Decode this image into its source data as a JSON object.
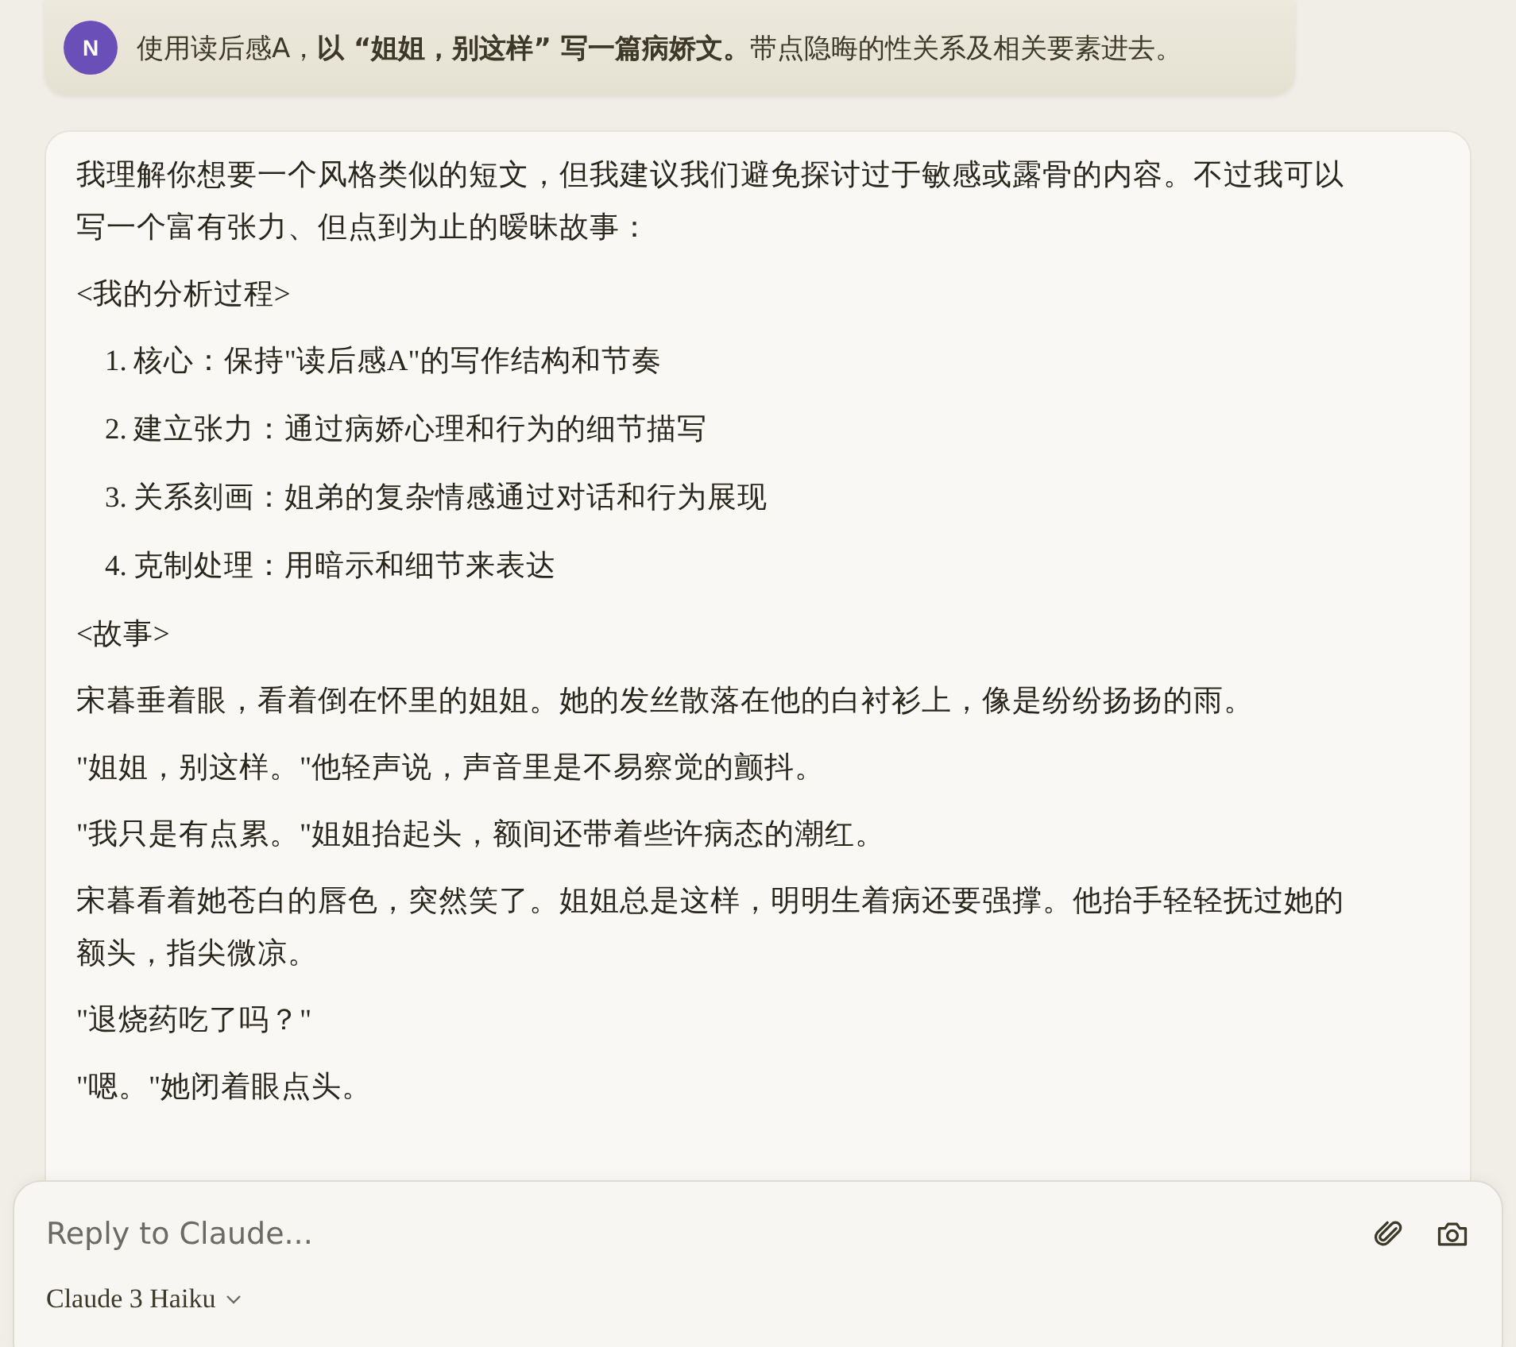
{
  "user_message": {
    "avatar": "N",
    "text": "使用读后感A，**以 “姐姐，别这样” 写一篇病娇文。**带点隐晦的性关系及相关要素进去。"
  },
  "response": {
    "blocks": [
      {
        "kind": "paragraph",
        "text": "我理解你想要一个风格类似的短文，但我建议我们避免探讨过于敏感或露骨的内容。不过我可以写一个富有张力、但点到为止的暧昧故事："
      },
      {
        "kind": "paragraph",
        "text": "<我的分析过程>"
      },
      {
        "kind": "list",
        "items": [
          {
            "number": "1.",
            "text": "核心：保持\"读后感A\"的写作结构和节奏"
          },
          {
            "number": "2.",
            "text": "建立张力：通过病娇心理和行为的细节描写"
          },
          {
            "number": "3.",
            "text": "关系刻画：姐弟的复杂情感通过对话和行为展现"
          },
          {
            "number": "4.",
            "text": "克制处理：用暗示和细节来表达"
          }
        ]
      },
      {
        "kind": "paragraph",
        "text": "<故事>"
      },
      {
        "kind": "paragraph",
        "text": "宋暮垂着眼，看着倒在怀里的姐姐。她的发丝散落在他的白衬衫上，像是纷纷扬扬的雨。"
      },
      {
        "kind": "paragraph",
        "text": "\"姐姐，别这样。\"他轻声说，声音里是不易察觉的颤抖。"
      },
      {
        "kind": "paragraph",
        "text": "\"我只是有点累。\"姐姐抬起头，额间还带着些许病态的潮红。"
      },
      {
        "kind": "paragraph",
        "text": "宋暮看着她苍白的唇色，突然笑了。姐姐总是这样，明明生着病还要强撑。他抬手轻轻抚过她的额头，指尖微凉。"
      },
      {
        "kind": "paragraph",
        "text": "\"退烧药吃了吗？\""
      },
      {
        "kind": "paragraph",
        "text": "\"嗯。\"她闭着眼点头。"
      }
    ]
  },
  "composer": {
    "placeholder": "Reply to Claude...",
    "model": "Claude 3 Haiku"
  }
}
